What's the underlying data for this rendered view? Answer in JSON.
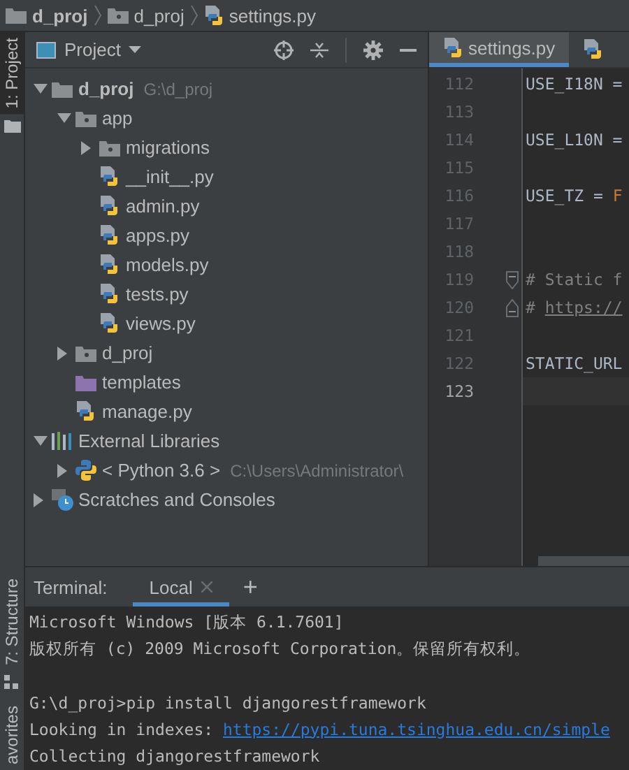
{
  "breadcrumb": [
    {
      "label": "d_proj",
      "kind": "project"
    },
    {
      "label": "d_proj",
      "kind": "folder"
    },
    {
      "label": "settings.py",
      "kind": "python"
    }
  ],
  "tool_strip": {
    "top": [
      {
        "label": "1: Project",
        "selected": true
      }
    ],
    "bottom": [
      {
        "label": "7: Structure",
        "selected": false
      },
      {
        "label": "avorites",
        "selected": false
      }
    ]
  },
  "project_panel": {
    "title": "Project",
    "tree": [
      {
        "label": "d_proj",
        "path": "G:\\d_proj",
        "kind": "folder",
        "bold": true,
        "expanded": true,
        "children": [
          {
            "label": "app",
            "kind": "folder",
            "expanded": true,
            "children": [
              {
                "label": "migrations",
                "kind": "folder",
                "expanded": false
              },
              {
                "label": "__init__.py",
                "kind": "python"
              },
              {
                "label": "admin.py",
                "kind": "python"
              },
              {
                "label": "apps.py",
                "kind": "python"
              },
              {
                "label": "models.py",
                "kind": "python"
              },
              {
                "label": "tests.py",
                "kind": "python"
              },
              {
                "label": "views.py",
                "kind": "python"
              }
            ]
          },
          {
            "label": "d_proj",
            "kind": "folder",
            "expanded": false
          },
          {
            "label": "templates",
            "kind": "templates"
          },
          {
            "label": "manage.py",
            "kind": "python"
          }
        ]
      },
      {
        "label": "External Libraries",
        "kind": "library",
        "expanded": true,
        "children": [
          {
            "label": "< Python 3.6 >",
            "path": "C:\\Users\\Administrator\\",
            "kind": "sdk",
            "expanded": false
          }
        ]
      },
      {
        "label": "Scratches and Consoles",
        "kind": "scratches",
        "expanded": false
      }
    ]
  },
  "editor": {
    "tabs": [
      {
        "label": "settings.py",
        "selected": true
      },
      {
        "selected": false
      }
    ],
    "lines": [
      {
        "number": "112",
        "current": false,
        "parts": [
          {
            "text": "USE_I18N =",
            "kind": "plain"
          }
        ]
      },
      {
        "number": "113",
        "current": false
      },
      {
        "number": "114",
        "current": false,
        "parts": [
          {
            "text": "USE_L10N =",
            "kind": "plain"
          }
        ]
      },
      {
        "number": "115",
        "current": false
      },
      {
        "number": "116",
        "current": false,
        "parts": [
          {
            "text": "USE_TZ = ",
            "kind": "plain"
          },
          {
            "text": "F",
            "kind": "keyword"
          }
        ]
      },
      {
        "number": "117",
        "current": false
      },
      {
        "number": "118",
        "current": false
      },
      {
        "number": "119",
        "current": false,
        "kind": "fold-start",
        "parts": [
          {
            "text": "# Static f",
            "kind": "comment"
          }
        ]
      },
      {
        "number": "120",
        "current": false,
        "kind": "fold-end",
        "parts": [
          {
            "text": "# ",
            "kind": "comment"
          },
          {
            "text": "https://",
            "kind": "link"
          }
        ]
      },
      {
        "number": "121",
        "current": false
      },
      {
        "number": "122",
        "current": false,
        "parts": [
          {
            "text": "STATIC_URL",
            "kind": "plain"
          }
        ]
      },
      {
        "number": "123",
        "current": true
      }
    ]
  },
  "terminal": {
    "title": "Terminal:",
    "tabs": [
      {
        "label": "Local",
        "selected": true
      }
    ],
    "add": "+",
    "lines": [
      {
        "parts": [
          {
            "text": "Microsoft Windows [版本 6.1.7601]",
            "kind": "plain"
          }
        ]
      },
      {
        "parts": [
          {
            "text": "版权所有 (c) 2009 Microsoft Corporation。保留所有权利。",
            "kind": "plain"
          }
        ]
      },
      {
        "blank": true
      },
      {
        "parts": [
          {
            "text": "G:\\d_proj>pip install djangorestframework",
            "kind": "plain"
          }
        ]
      },
      {
        "parts": [
          {
            "text": "Looking in indexes: ",
            "kind": "plain"
          },
          {
            "text": "https://pypi.tuna.tsinghua.edu.cn/simple",
            "kind": "link"
          }
        ]
      },
      {
        "parts": [
          {
            "text": "Collecting djangorestframework",
            "kind": "plain"
          }
        ]
      }
    ]
  }
}
